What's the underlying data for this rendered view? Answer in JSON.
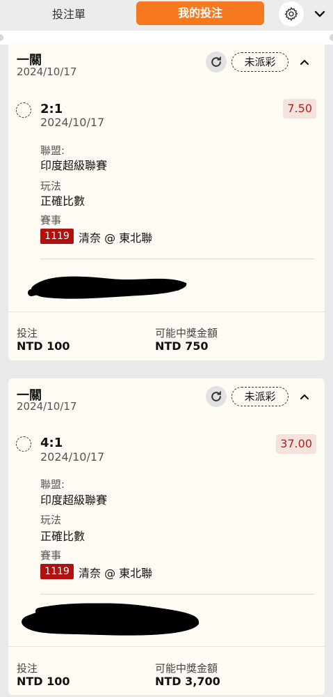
{
  "tabs": {
    "betslip": "投注單",
    "mybets": "我的投注"
  },
  "icons": {
    "settings": "gear-icon",
    "collapse_menu": "chevron-down-icon",
    "refresh": "refresh-icon",
    "card_toggle": "chevron-up-icon"
  },
  "colors": {
    "accent": "#f6791f",
    "odds_text": "#b0211c",
    "match_badge": "#b0110e"
  },
  "bets": [
    {
      "type": "一關",
      "date": "2024/10/17",
      "status": "未派彩",
      "selection": "2:1",
      "selection_date": "2024/10/17",
      "odds": "7.50",
      "league_label": "聯盟:",
      "league": "印度超級聯賽",
      "market_label": "玩法",
      "market": "正確比數",
      "event_label": "賽事",
      "match_id": "1119",
      "match": "清奈 @ 東北聯",
      "stake_label": "投注",
      "stake": "NTD 100",
      "payout_label": "可能中獎金額",
      "payout": "NTD 750"
    },
    {
      "type": "一關",
      "date": "2024/10/17",
      "status": "未派彩",
      "selection": "4:1",
      "selection_date": "2024/10/17",
      "odds": "37.00",
      "league_label": "聯盟:",
      "league": "印度超級聯賽",
      "market_label": "玩法",
      "market": "正確比數",
      "event_label": "賽事",
      "match_id": "1119",
      "match": "清奈 @ 東北聯",
      "stake_label": "投注",
      "stake": "NTD 100",
      "payout_label": "可能中獎金額",
      "payout": "NTD 3,700"
    }
  ]
}
